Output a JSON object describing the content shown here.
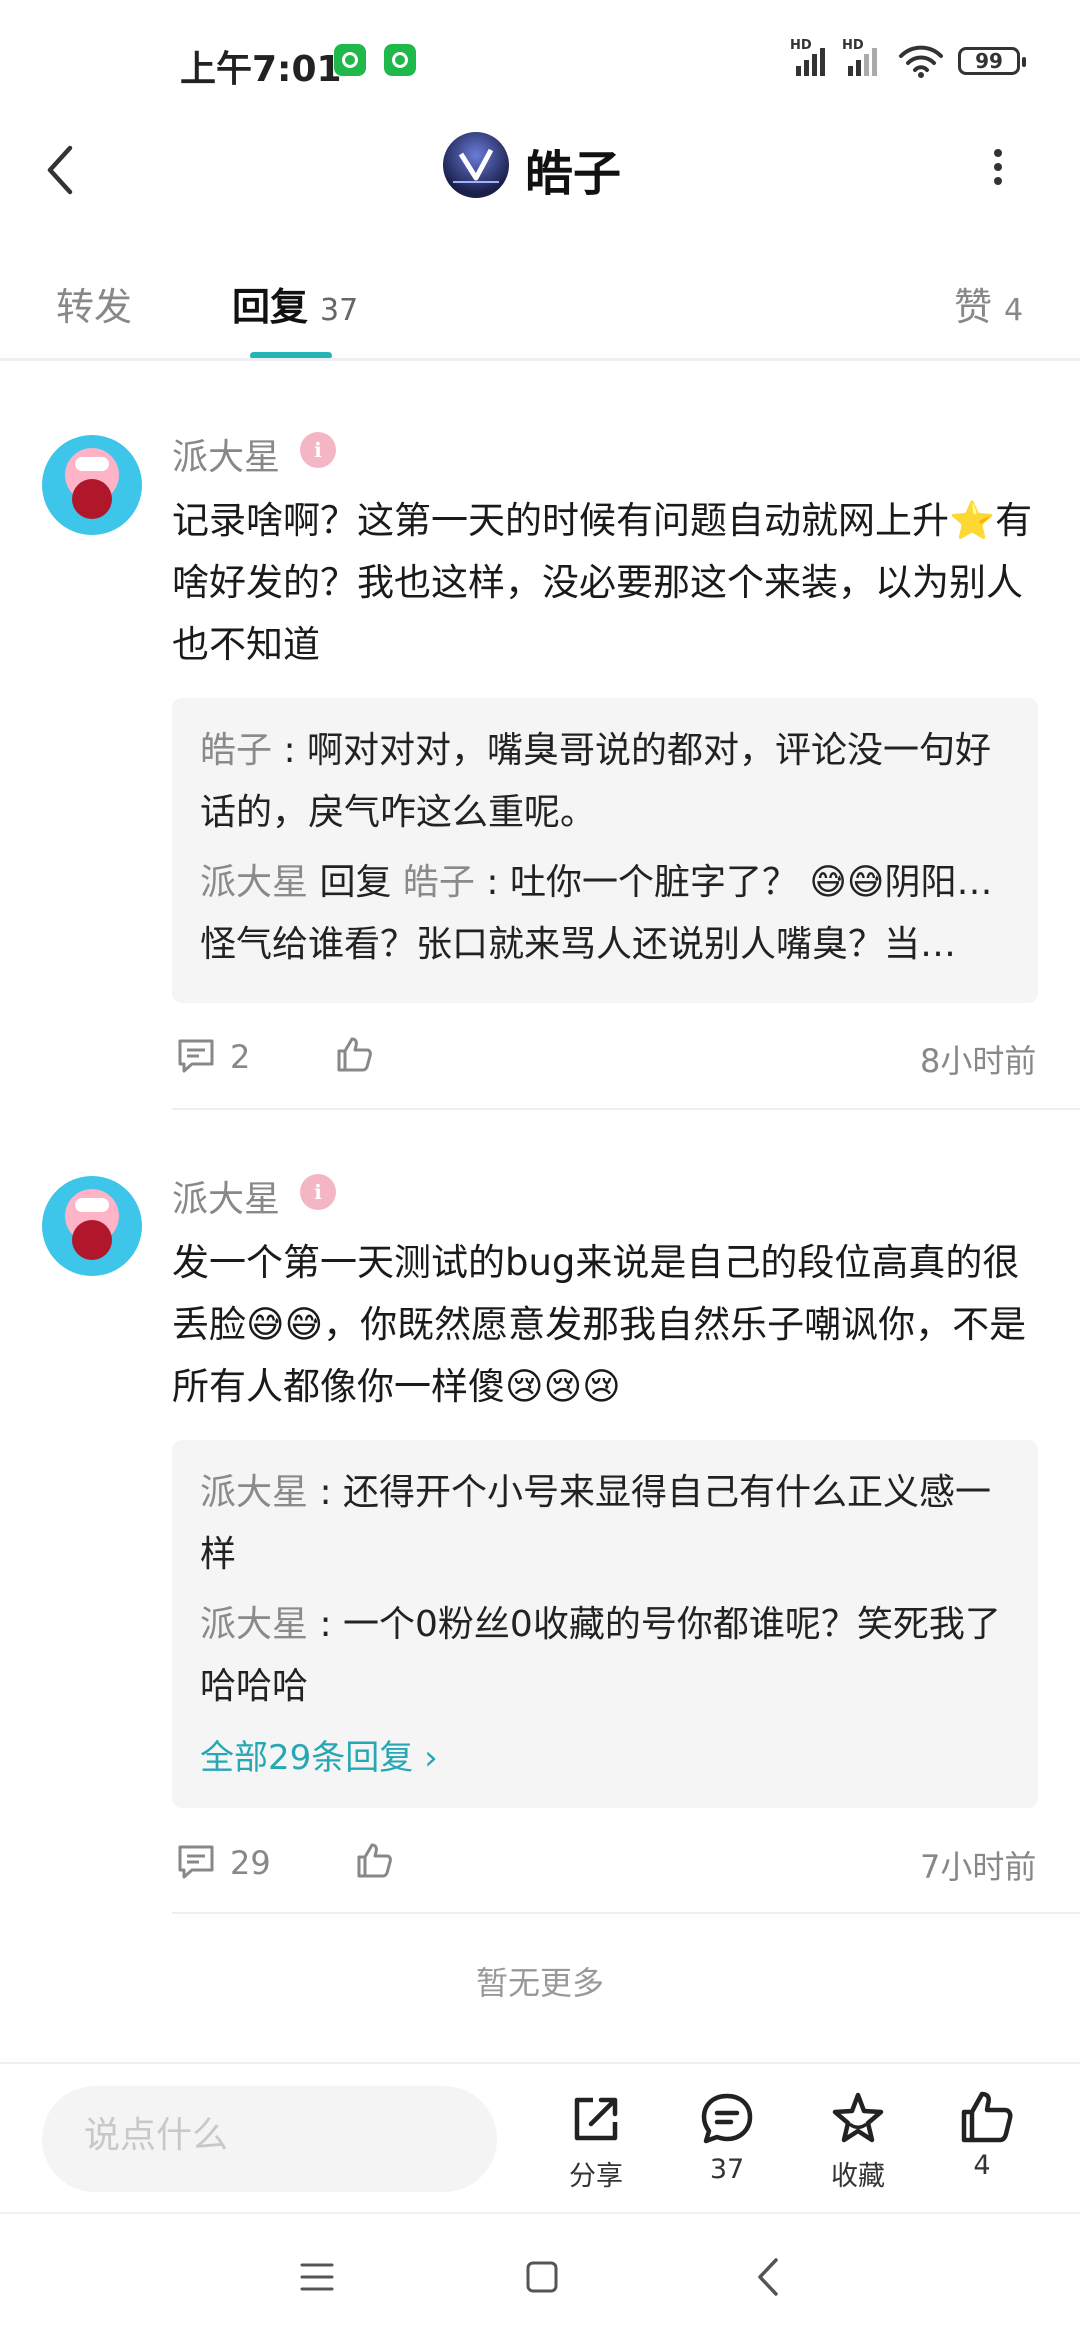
{
  "status_bar": {
    "time": "上午7:01",
    "signal_1_tag": "HD",
    "signal_2_tag": "HD",
    "battery": "99"
  },
  "header": {
    "title": "皓子",
    "back_icon": "chevron-left-icon",
    "more_icon": "more-vertical-icon"
  },
  "tabs": [
    {
      "label": "转发",
      "count": ""
    },
    {
      "label": "回复",
      "count": "37"
    },
    {
      "label": "赞",
      "count": "4"
    }
  ],
  "comments": [
    {
      "name": "派大星",
      "text": "记录啥啊？这第一天的时候有问题自动就网上升⭐有啥好发的？我也这样，没必要那这个来装，以为别人也不知道",
      "replies": [
        {
          "from": "皓子",
          "to": "",
          "connector": "",
          "text": " : 啊对对对，嘴臭哥说的都对，评论没一句好话的，戾气咋这么重呢。"
        },
        {
          "from": "派大星",
          "connector": " 回复 ",
          "to": "皓子",
          "text": " : 吐你一个脏字了？ 😅😅阴阳怪气给谁看？张口就来骂人还说别人嘴臭？当…"
        }
      ],
      "view_all": "",
      "reply_count": "2",
      "time": "8小时前"
    },
    {
      "name": "派大星",
      "text": "发一个第一天测试的bug来说是自己的段位高真的很丢脸😅😅，你既然愿意发那我自然乐子嘲讽你，不是所有人都像你一样傻😢😢😢",
      "replies": [
        {
          "from": "派大星",
          "text": " : 还得开个小号来显得自己有什么正义感一样"
        },
        {
          "from": "派大星",
          "text": " : 一个0粉丝0收藏的号你都谁呢？笑死我了哈哈哈"
        }
      ],
      "view_all": "全部29条回复 ›",
      "reply_count": "29",
      "time": "7小时前"
    }
  ],
  "no_more": "暂无更多",
  "bottom_bar": {
    "placeholder": "说点什么",
    "share_label": "分享",
    "comment_count": "37",
    "favorite_label": "收藏",
    "like_count": "4"
  },
  "colors": {
    "accent": "#25b5b4",
    "link": "#25a7b4",
    "muted": "#888888"
  }
}
